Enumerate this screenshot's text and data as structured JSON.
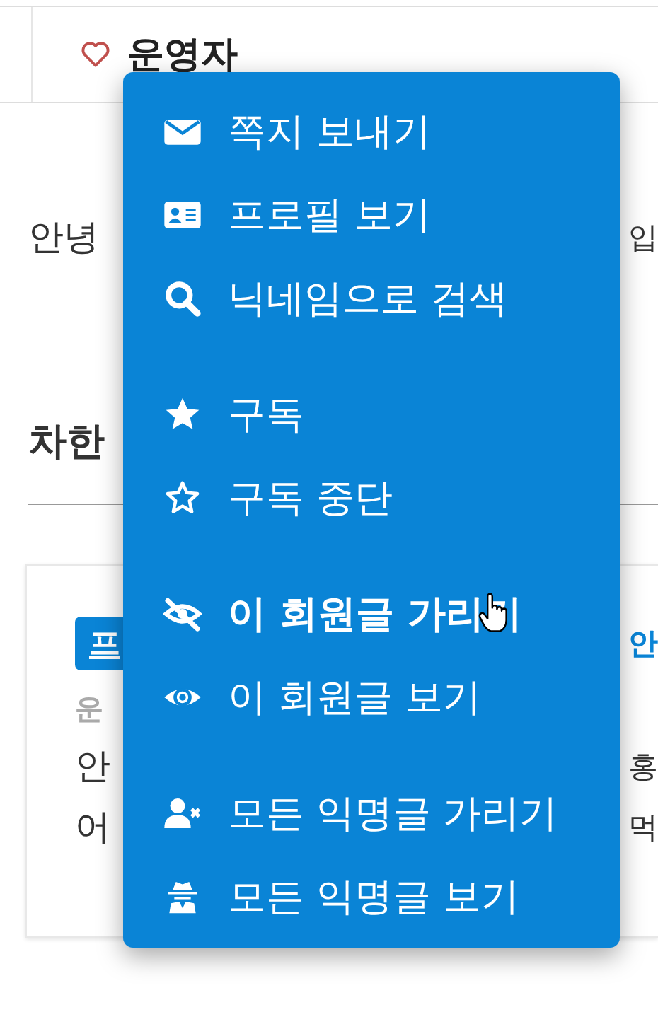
{
  "header": {
    "author": "운영자"
  },
  "intro": {
    "left": "안녕",
    "right": "입"
  },
  "section_title": "차한",
  "card": {
    "badge": "프",
    "title": "안",
    "author": "운",
    "lines": [
      {
        "left": "안",
        "right": "홍"
      },
      {
        "left": "어",
        "right": "먹"
      }
    ]
  },
  "menu": {
    "groups": [
      [
        {
          "label": "쪽지 보내기",
          "hovered": false
        },
        {
          "label": "프로필 보기",
          "hovered": false
        },
        {
          "label": "닉네임으로 검색",
          "hovered": false
        }
      ],
      [
        {
          "label": "구독",
          "hovered": false
        },
        {
          "label": "구독 중단",
          "hovered": false
        }
      ],
      [
        {
          "label": "이 회원글 가리기",
          "hovered": true
        },
        {
          "label": "이 회원글 보기",
          "hovered": false
        }
      ],
      [
        {
          "label": "모든 익명글 가리기",
          "hovered": false
        },
        {
          "label": "모든 익명글 보기",
          "hovered": false
        }
      ]
    ]
  }
}
